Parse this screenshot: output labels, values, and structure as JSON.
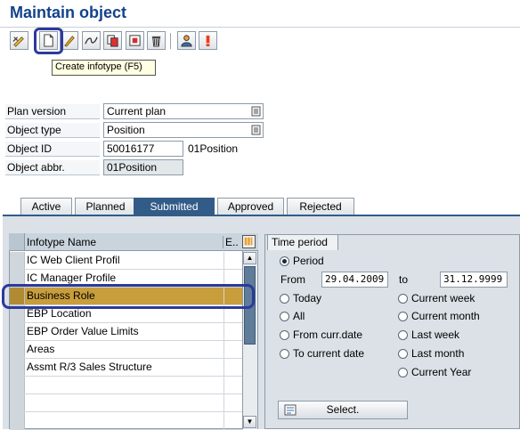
{
  "header": {
    "title": "Maintain object"
  },
  "toolbar": {
    "tooltip": "Create infotype   (F5)",
    "buttons": [
      "change-icon",
      "create-icon",
      "edit-icon",
      "delimit-icon",
      "copy-icon",
      "overview-icon",
      "delete-icon",
      "person-icon",
      "info-icon"
    ]
  },
  "form": {
    "plan_version": {
      "label": "Plan version",
      "value": "Current plan"
    },
    "object_type": {
      "label": "Object type",
      "value": "Position"
    },
    "object_id": {
      "label": "Object ID",
      "value": "50016177",
      "text": "01Position"
    },
    "object_abbr": {
      "label": "Object abbr.",
      "value": "01Position"
    }
  },
  "tabs": [
    "Active",
    "Planned",
    "Submitted",
    "Approved",
    "Rejected"
  ],
  "active_tab": "Submitted",
  "table": {
    "header": "Infotype Name",
    "header_e": "E..",
    "rows": [
      "IC Web Client Profil",
      "IC Manager Profile",
      "Business Role",
      "EBP Location",
      "EBP Order Value Limits",
      "Areas",
      "Assmt R/3 Sales Structure",
      "",
      "",
      ""
    ],
    "selected_row": "Business Role"
  },
  "time_period": {
    "title": "Time period",
    "period_label": "Period",
    "from_label": "From",
    "from_value": "29.04.2009",
    "to_label": "to",
    "to_value": "31.12.9999",
    "options_left": [
      "Today",
      "All",
      "From curr.date",
      "To current date"
    ],
    "options_right": [
      "Current week",
      "Current month",
      "Last week",
      "Last month",
      "Current Year"
    ],
    "select_button": "Select."
  },
  "colors": {
    "title": "#13428b",
    "active_tab": "#325c87",
    "selected_row": "#c89d3c",
    "highlight": "#2b3a9c"
  }
}
